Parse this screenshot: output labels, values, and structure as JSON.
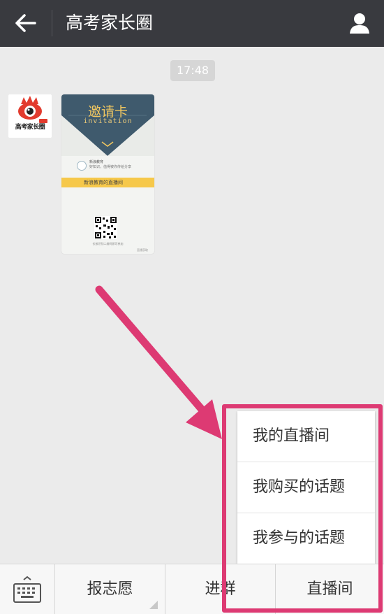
{
  "header": {
    "title": "高考家长圈"
  },
  "chat": {
    "timestamp": "17:48",
    "avatar_text": "高考家长圈",
    "card": {
      "title": "邀请卡",
      "subtitle": "invitation",
      "org_name": "新浪教育",
      "org_desc": "好知识，值得被你传给分享",
      "banner": "新浪教育的直播间",
      "qr_caption": "长按识别二维码即可参加",
      "footer": "直播获取"
    }
  },
  "popup_menu": {
    "items": [
      "我的直播间",
      "我购买的话题",
      "我参与的话题"
    ]
  },
  "bottom_bar": {
    "tabs": [
      "报志愿",
      "进群",
      "直播间"
    ]
  },
  "colors": {
    "header_bg": "#393a3f",
    "highlight": "#dd3a73",
    "chat_bg": "#ebebeb"
  }
}
